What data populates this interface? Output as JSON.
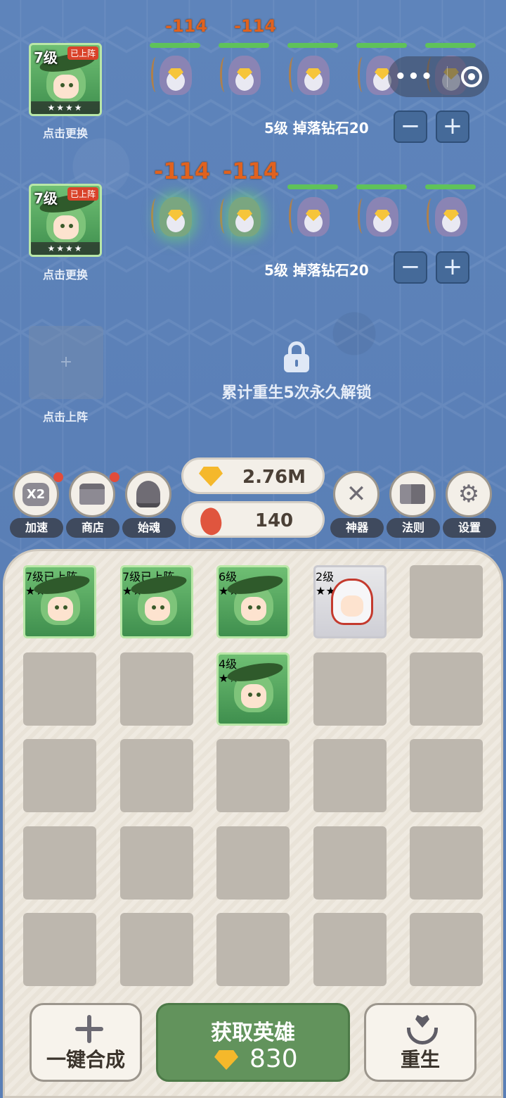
{
  "lanes": [
    {
      "hero": {
        "level": "7级",
        "badge": "已上阵",
        "stars": "★★★★"
      },
      "caption": "点击更换",
      "monsters": [
        {
          "damage": "-114",
          "hit": false
        },
        {
          "damage": "-114",
          "hit": false
        },
        {
          "damage": "",
          "hit": false
        },
        {
          "damage": "",
          "hit": false
        },
        {
          "damage": "",
          "hit": false
        }
      ],
      "level_info": "5级 掉落钻石20",
      "minus": "−",
      "plus": "+"
    },
    {
      "hero": {
        "level": "7级",
        "badge": "已上阵",
        "stars": "★★★★"
      },
      "caption": "点击更换",
      "monsters": [
        {
          "damage": "-114",
          "hit": true
        },
        {
          "damage": "-114",
          "hit": true
        },
        {
          "damage": "",
          "hit": false
        },
        {
          "damage": "",
          "hit": false
        },
        {
          "damage": "",
          "hit": false
        }
      ],
      "level_info": "5级 掉落钻石20",
      "minus": "−",
      "plus": "+"
    }
  ],
  "locked_lane": {
    "plus": "+",
    "caption": "点击上阵",
    "unlock_text": "累计重生5次永久解锁"
  },
  "toolbar_left": [
    {
      "icon": "bag-x2-icon",
      "glyph": "X2",
      "label": "加速",
      "dot": true
    },
    {
      "icon": "shop-icon",
      "glyph": "",
      "label": "商店",
      "dot": true
    },
    {
      "icon": "helmet-icon",
      "glyph": "",
      "label": "始魂",
      "dot": false
    }
  ],
  "toolbar_right": [
    {
      "icon": "axe-icon",
      "label": "神器"
    },
    {
      "icon": "book-icon",
      "label": "法则"
    },
    {
      "icon": "gear-icon",
      "label": "设置"
    }
  ],
  "resources": {
    "diamonds": "2.76M",
    "meat": "140"
  },
  "inventory": [
    {
      "level": "7级",
      "badge": "已上阵",
      "stars": "★★★★",
      "type": "green"
    },
    {
      "level": "7级",
      "badge": "已上阵",
      "stars": "★★★★",
      "type": "green"
    },
    {
      "level": "6级",
      "badge": "",
      "stars": "★★★☆",
      "type": "green"
    },
    {
      "level": "2级",
      "badge": "",
      "stars": "★★☆",
      "type": "white"
    },
    null,
    null,
    null,
    {
      "level": "4级",
      "badge": "",
      "stars": "★☆☆☆",
      "type": "green"
    },
    null,
    null,
    null,
    null,
    null,
    null,
    null,
    null,
    null,
    null,
    null,
    null,
    null,
    null,
    null,
    null,
    null
  ],
  "buttons": {
    "merge": "一键合成",
    "get_hero": "获取英雄",
    "get_hero_cost": "830",
    "rebirth": "重生"
  }
}
